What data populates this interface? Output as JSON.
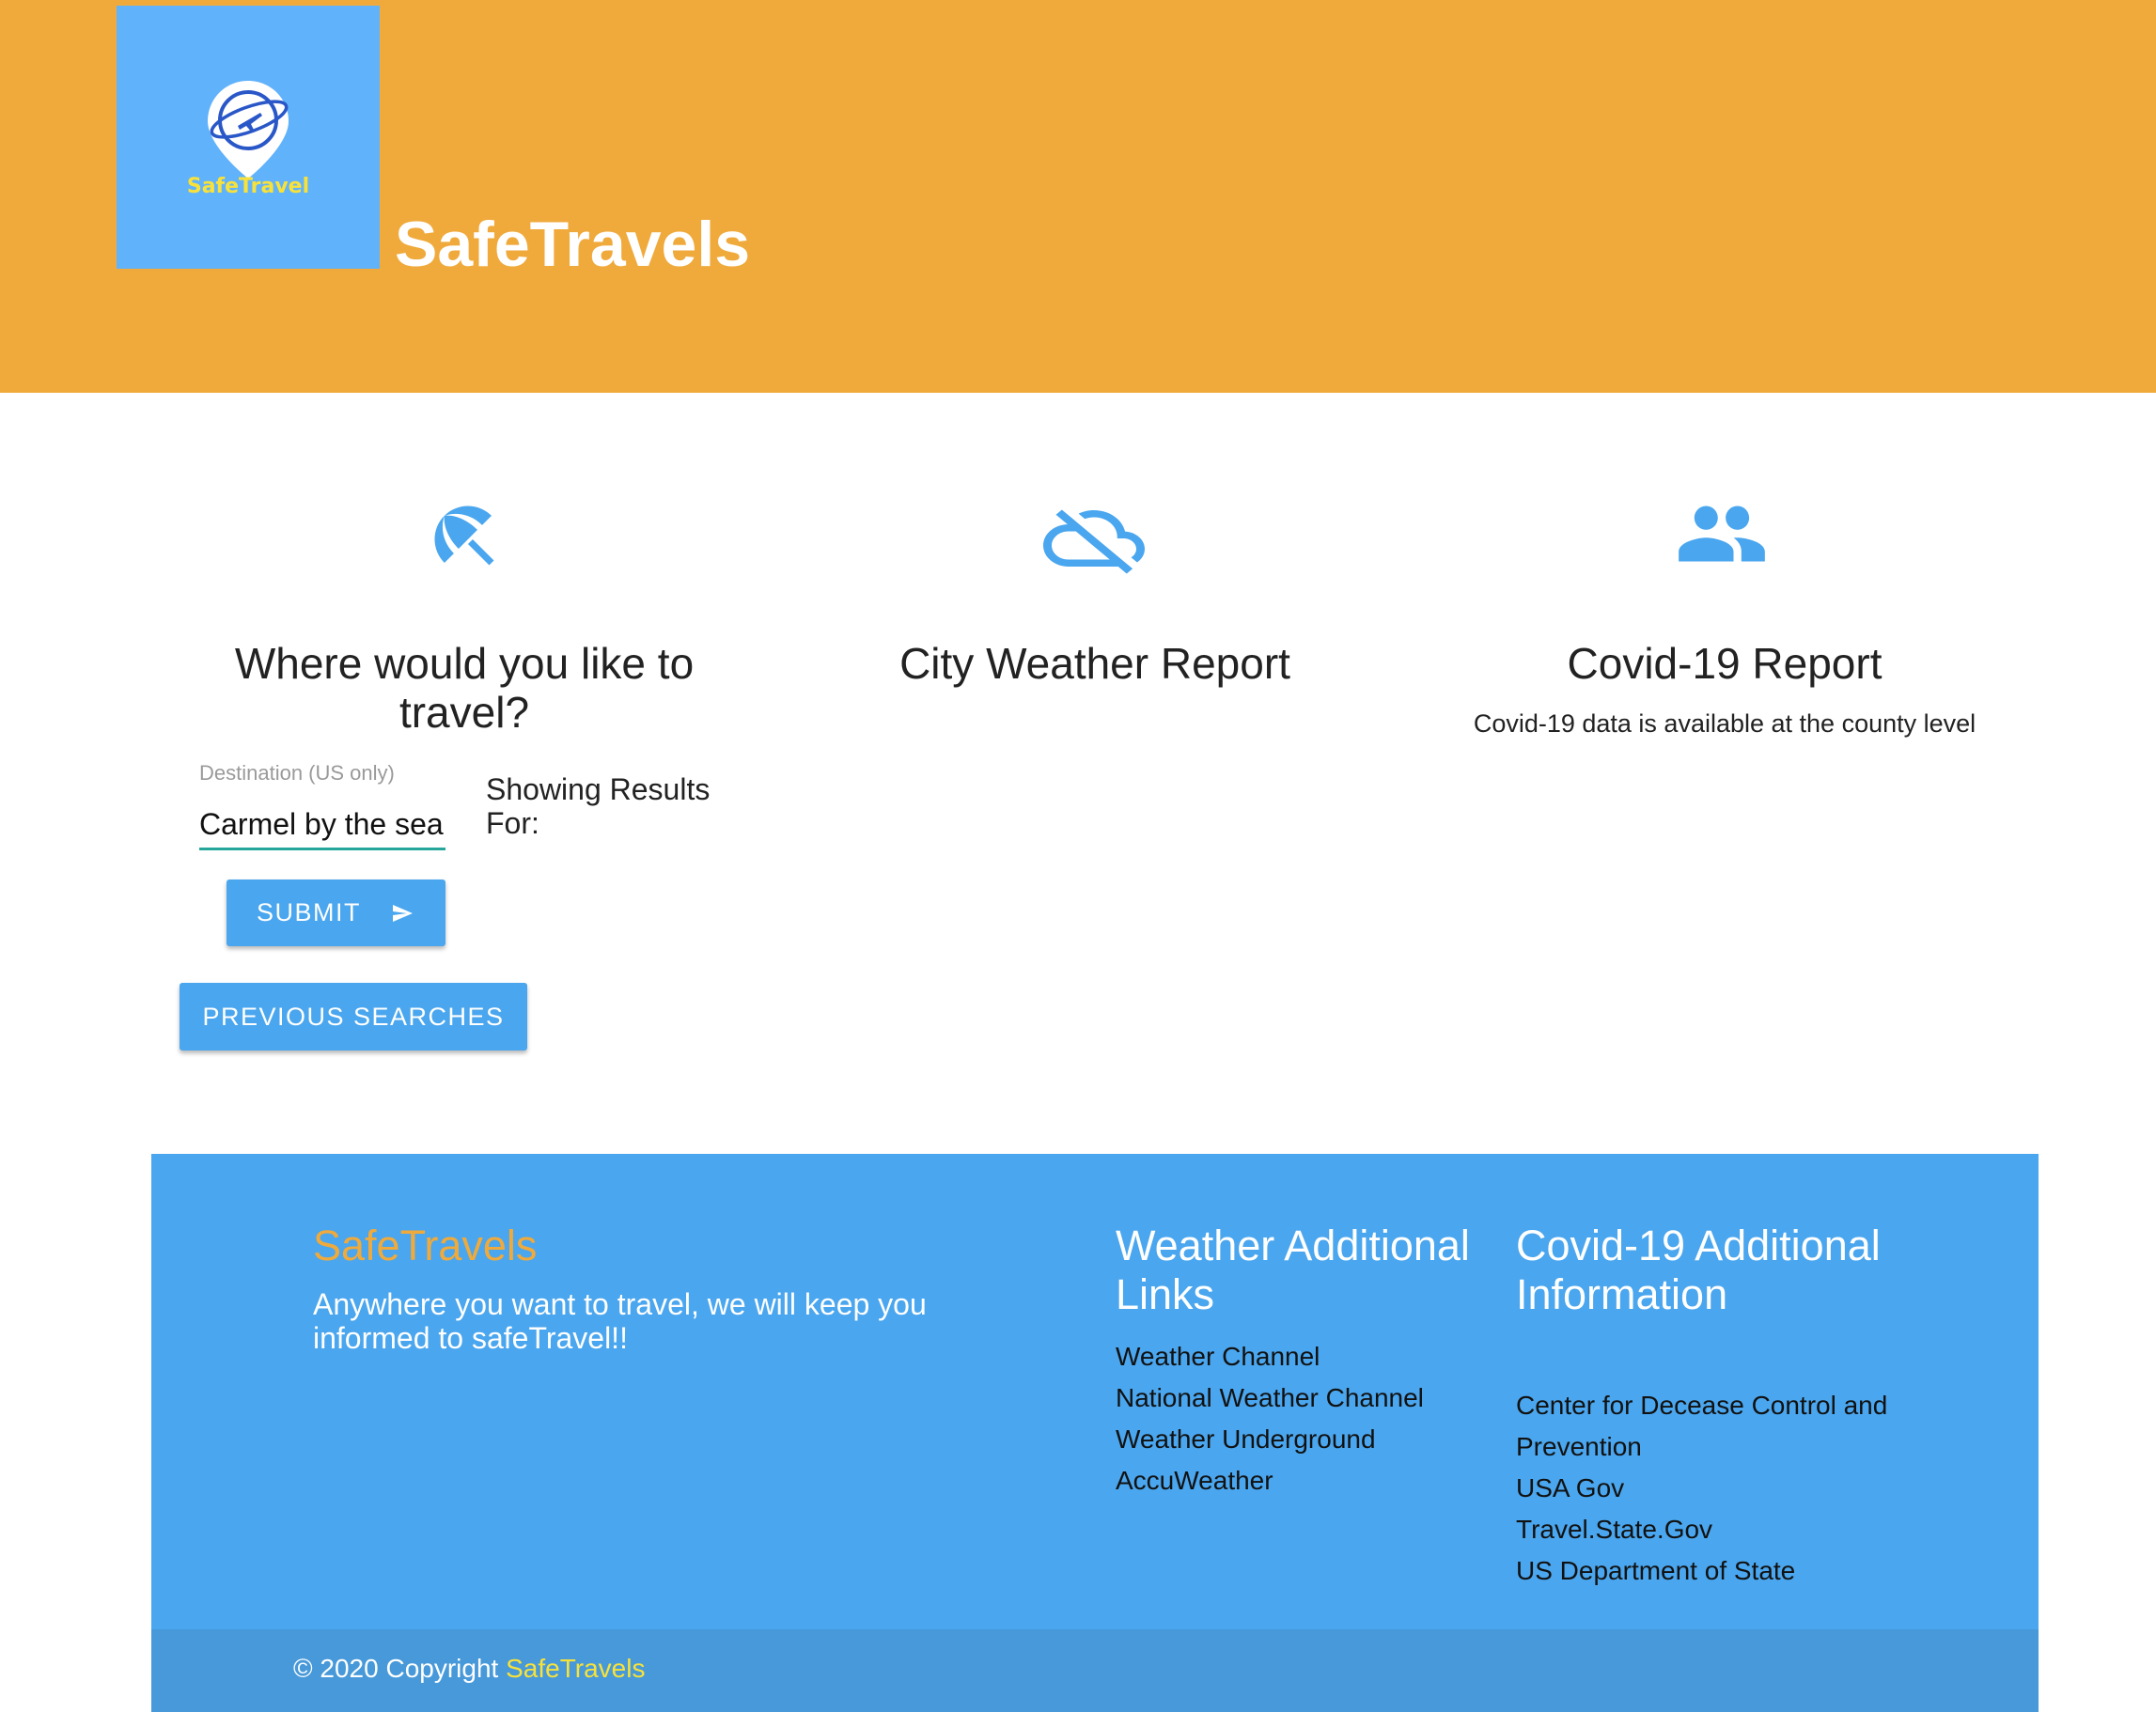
{
  "header": {
    "logo_text": "SafeTravel",
    "title": "SafeTravels"
  },
  "colors": {
    "header_bg": "#f0aa3c",
    "logo_bg": "#60b2fb",
    "accent_blue": "#4aa6ee",
    "input_underline": "#26a69a",
    "footer_brand": "#f0aa3c",
    "copyright_brand": "#f8e23a"
  },
  "columns": {
    "search": {
      "icon": "beach-umbrella-icon",
      "heading": "Where would you like to travel?"
    },
    "weather": {
      "icon": "cloud-off-icon",
      "heading": "City Weather Report"
    },
    "covid": {
      "icon": "people-icon",
      "heading": "Covid-19 Report",
      "subtitle": "Covid-19 data is available at the county level"
    }
  },
  "search_form": {
    "destination_label": "Destination (US only)",
    "destination_value": "Carmel by the sea",
    "results_label": "Showing Results For:",
    "submit_label": "Submit",
    "submit_icon": "send-icon",
    "previous_searches_label": "Previous Searches"
  },
  "footer": {
    "brand": "SafeTravels",
    "tagline": "Anywhere you want to travel, we will keep you informed to safeTravel!!",
    "weather_heading": "Weather Additional Links",
    "weather_links": [
      "Weather Channel",
      "National Weather Channel",
      "Weather Underground",
      "AccuWeather"
    ],
    "covid_heading": "Covid-19 Additional Information",
    "covid_links": [
      "Center for Decease Control and Prevention",
      "USA Gov",
      "Travel.State.Gov",
      "US Department of State"
    ],
    "copyright_prefix": "© 2020 Copyright ",
    "copyright_brand": "SafeTravels"
  }
}
